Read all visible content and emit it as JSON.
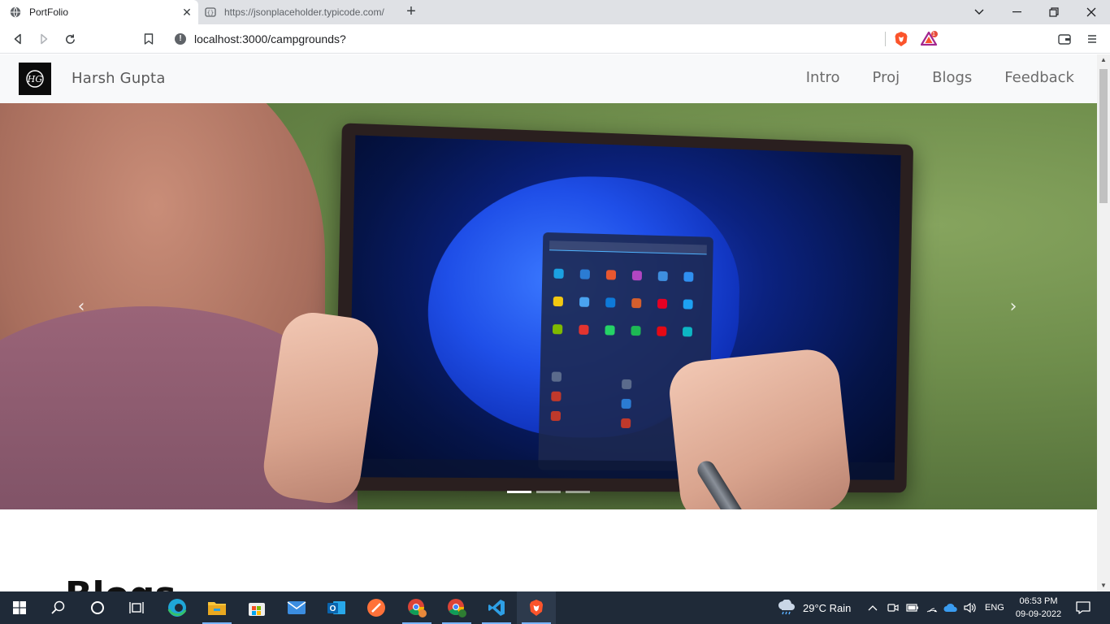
{
  "browser": {
    "tabs": [
      {
        "title": "PortFolio",
        "active": true
      },
      {
        "title": "https://jsonplaceholder.typicode.com/",
        "active": false
      }
    ],
    "address": "localhost:3000/campgrounds?",
    "brave_badge_count": "1"
  },
  "navbar": {
    "brand": "Harsh Gupta",
    "logo_text": "HG",
    "links": [
      "Intro",
      "Proj",
      "Blogs",
      "Feedback"
    ]
  },
  "carousel": {
    "slide_count": 3,
    "active_slide": 0,
    "prev_glyph": "‹",
    "next_glyph": "›"
  },
  "section": {
    "title": "Blogs"
  },
  "taskbar": {
    "weather": "29°C  Rain",
    "language": "ENG",
    "time": "06:53 PM",
    "date": "09-09-2022"
  },
  "colors": {
    "taskbar_bg": "#1f2a38",
    "navbar_bg": "#f8f9fa",
    "brave_orange": "#fb542b"
  }
}
